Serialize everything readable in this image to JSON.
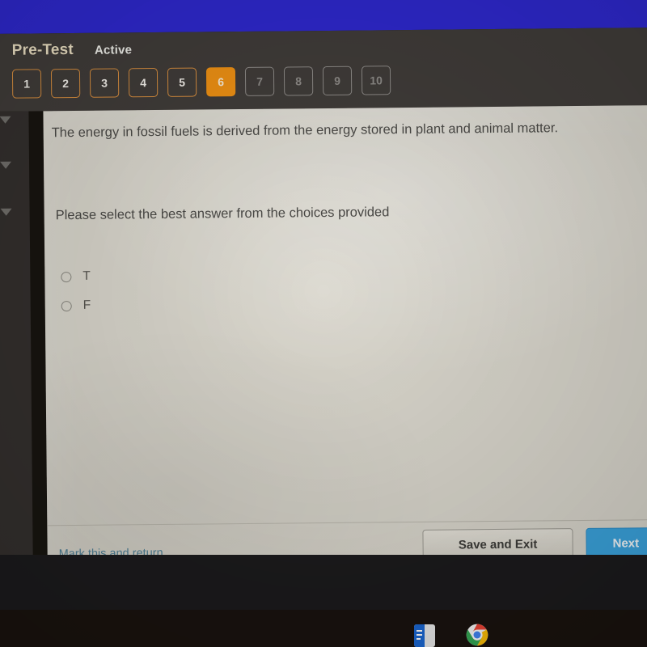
{
  "window": {
    "top_bar_color": "#2e28cf",
    "header_bg_color": "#403c39",
    "panel_bg_color": "#d8d5cb"
  },
  "header": {
    "test_title": "Pre-Test",
    "status_label": "Active",
    "title_color": "#ece0c3",
    "status_color": "#efefea"
  },
  "pager": {
    "accent_color": "#ef9113",
    "items": [
      {
        "label": "1",
        "state": "done"
      },
      {
        "label": "2",
        "state": "done"
      },
      {
        "label": "3",
        "state": "done"
      },
      {
        "label": "4",
        "state": "done"
      },
      {
        "label": "5",
        "state": "done"
      },
      {
        "label": "6",
        "state": "current"
      },
      {
        "label": "7",
        "state": "disabled"
      },
      {
        "label": "8",
        "state": "disabled"
      },
      {
        "label": "9",
        "state": "disabled"
      },
      {
        "label": "10",
        "state": "disabled"
      }
    ]
  },
  "question": {
    "prompt": "The energy in fossil fuels is derived from the energy stored in plant and animal matter.",
    "instruction": "Please select the best answer from the choices provided",
    "choices": [
      {
        "label": "T",
        "selected": false
      },
      {
        "label": "F",
        "selected": false
      }
    ]
  },
  "footer": {
    "mark_link": "Mark this and return",
    "mark_link_color": "#4f7f95",
    "save_button": "Save and Exit",
    "next_button": "Next",
    "next_button_color": "#3aa3dd"
  },
  "taskbar": {
    "icons": [
      {
        "name": "docs-icon"
      },
      {
        "name": "chrome-icon"
      }
    ]
  }
}
